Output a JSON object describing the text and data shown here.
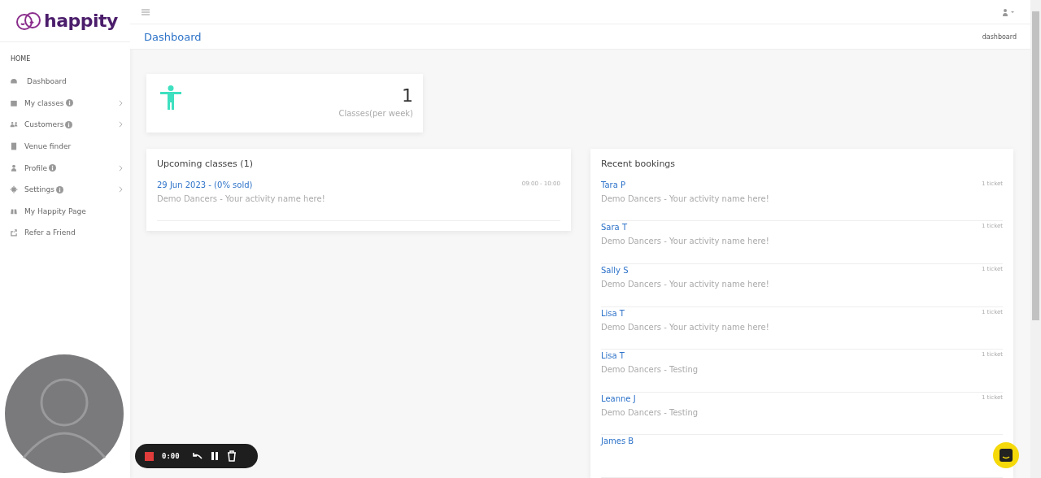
{
  "brand": {
    "name": "happity"
  },
  "sidebar": {
    "section": "HOME",
    "items": [
      {
        "label": "Dashboard",
        "info": false,
        "expandable": false
      },
      {
        "label": "My classes",
        "info": true,
        "expandable": true
      },
      {
        "label": "Customers",
        "info": true,
        "expandable": true
      },
      {
        "label": "Venue finder",
        "info": false,
        "expandable": false
      },
      {
        "label": "Profile",
        "info": true,
        "expandable": true
      },
      {
        "label": "Settings",
        "info": true,
        "expandable": true
      },
      {
        "label": "My Happity Page",
        "info": false,
        "expandable": false
      },
      {
        "label": "Refer a Friend",
        "info": false,
        "expandable": false
      }
    ]
  },
  "page": {
    "title": "Dashboard",
    "breadcrumb": "dashboard"
  },
  "stat": {
    "value": "1",
    "label": "Classes(per week)"
  },
  "upcoming": {
    "title": "Upcoming classes (1)",
    "items": [
      {
        "date": "29 Jun 2023 - (0% sold)",
        "time": "09:00 - 10:00",
        "description": "Demo Dancers - Your activity name here!"
      }
    ]
  },
  "bookings": {
    "title": "Recent bookings",
    "items": [
      {
        "name": "Tara P",
        "tickets": "1 ticket",
        "description": "Demo Dancers - Your activity name here!"
      },
      {
        "name": "Sara T",
        "tickets": "1 ticket",
        "description": "Demo Dancers - Your activity name here!"
      },
      {
        "name": "Sally S",
        "tickets": "1 ticket",
        "description": "Demo Dancers - Your activity name here!"
      },
      {
        "name": "Lisa T",
        "tickets": "1 ticket",
        "description": "Demo Dancers - Your activity name here!"
      },
      {
        "name": "Lisa T",
        "tickets": "1 ticket",
        "description": "Demo Dancers - Testing"
      },
      {
        "name": "Leanne J",
        "tickets": "1 ticket",
        "description": "Demo Dancers - Testing"
      },
      {
        "name": "James B"
      }
    ]
  },
  "recorder": {
    "time": "0:00"
  }
}
